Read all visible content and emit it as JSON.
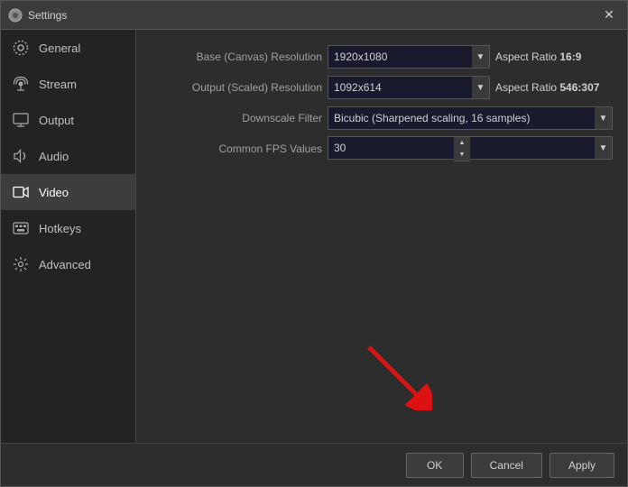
{
  "window": {
    "title": "Settings",
    "close_label": "✕"
  },
  "sidebar": {
    "items": [
      {
        "id": "general",
        "label": "General",
        "active": false
      },
      {
        "id": "stream",
        "label": "Stream",
        "active": false
      },
      {
        "id": "output",
        "label": "Output",
        "active": false
      },
      {
        "id": "audio",
        "label": "Audio",
        "active": false
      },
      {
        "id": "video",
        "label": "Video",
        "active": true
      },
      {
        "id": "hotkeys",
        "label": "Hotkeys",
        "active": false
      },
      {
        "id": "advanced",
        "label": "Advanced",
        "active": false
      }
    ]
  },
  "form": {
    "base_resolution_label": "Base (Canvas) Resolution",
    "base_resolution_value": "1920x1080",
    "base_aspect_ratio": "Aspect Ratio ",
    "base_aspect_ratio_bold": "16:9",
    "output_resolution_label": "Output (Scaled) Resolution",
    "output_resolution_value": "1092x614",
    "output_aspect_ratio": "Aspect Ratio ",
    "output_aspect_ratio_bold": "546:307",
    "downscale_label": "Downscale Filter",
    "downscale_value": "Bicubic (Sharpened scaling, 16 samples)",
    "fps_label": "Common FPS Values",
    "fps_value": "30"
  },
  "footer": {
    "ok_label": "OK",
    "cancel_label": "Cancel",
    "apply_label": "Apply"
  }
}
